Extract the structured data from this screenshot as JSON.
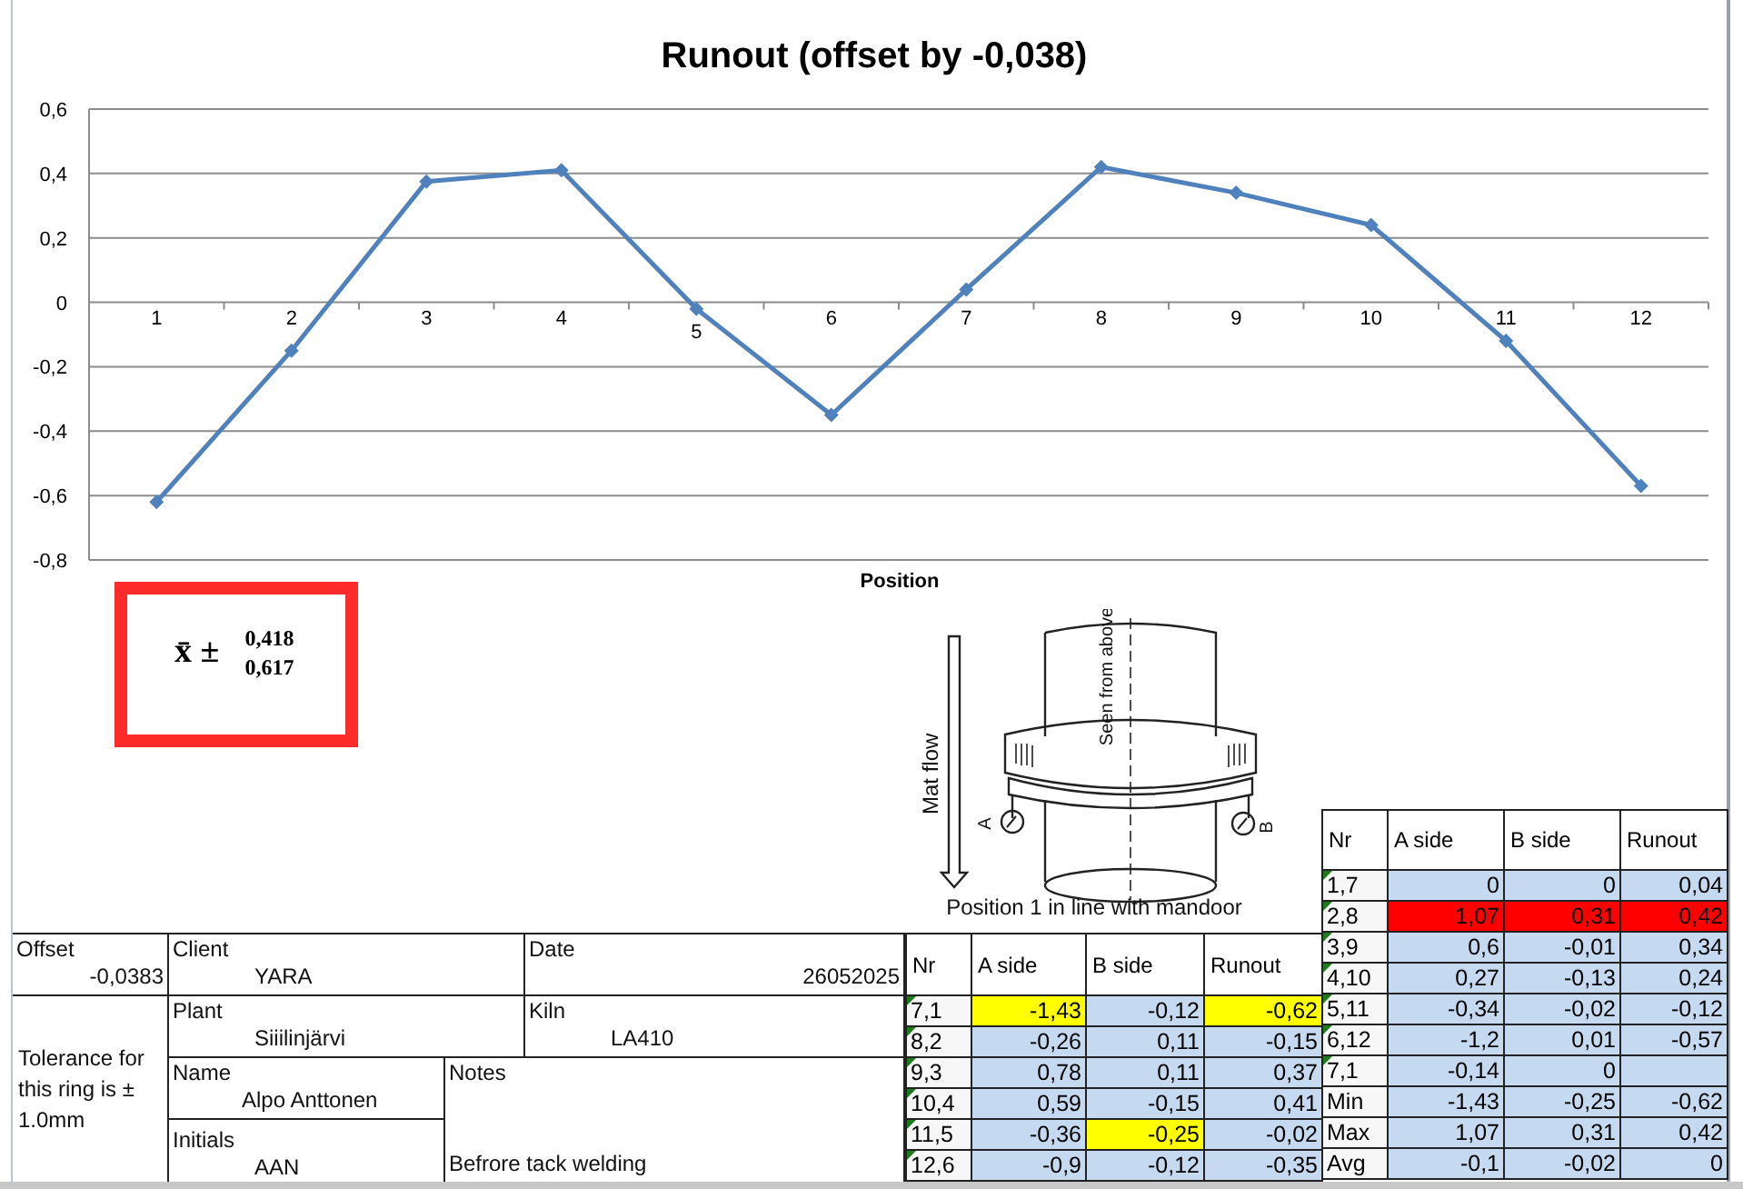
{
  "chart": {
    "chart_data": {
      "type": "line",
      "title": "Runout (offset by -0,038)",
      "xlabel": "Position",
      "categories": [
        "1",
        "2",
        "3",
        "4",
        "5",
        "6",
        "7",
        "8",
        "9",
        "10",
        "11",
        "12"
      ],
      "grid": true,
      "series": [
        {
          "color": "#4f81bd",
          "marker": "diamond",
          "values": [
            -0.62,
            -0.15,
            0.375,
            0.41,
            -0.02,
            -0.35,
            0.04,
            0.42,
            0.34,
            0.24,
            -0.12,
            -0.57
          ]
        }
      ],
      "ylim": [
        -0.8,
        0.6
      ],
      "yticks": [
        {
          "value": 0.6,
          "label": "0,6"
        },
        {
          "value": 0.4,
          "label": "0,4"
        },
        {
          "value": 0.2,
          "label": "0,2"
        },
        {
          "value": 0,
          "label": "0"
        },
        {
          "value": -0.2,
          "label": "-0,2"
        },
        {
          "value": -0.4,
          "label": "-0,4"
        },
        {
          "value": -0.6,
          "label": "-0,6"
        },
        {
          "value": -0.8,
          "label": "-0,8"
        }
      ]
    }
  },
  "stat_box": {
    "symbol": "x̄ ±",
    "values": [
      "0,418",
      "0,617"
    ]
  },
  "diagram": {
    "flow_label": "Mat flow",
    "view_label": "Seen from above",
    "gauge_labels": [
      "A",
      "B"
    ],
    "caption": "Position 1 in line with mandoor"
  },
  "info": [
    {
      "kind": "offset",
      "label": "Offset",
      "value": "-0,0383"
    },
    {
      "kind": "client",
      "label": "Client",
      "value": "YARA"
    },
    {
      "kind": "date",
      "label": "Date",
      "value": "26052025"
    },
    {
      "kind": "tolerance",
      "value": "Tolerance for this ring is ± 1.0mm"
    },
    {
      "kind": "plant",
      "label": "Plant",
      "value": "Siiilinjärvi"
    },
    {
      "kind": "kiln",
      "label": "Kiln",
      "value": "LA410"
    },
    {
      "kind": "name",
      "label": "Name",
      "value": "Alpo Anttonen"
    },
    {
      "kind": "initials",
      "label": "Initials",
      "value": "AAN"
    },
    {
      "kind": "notes",
      "label": "Notes",
      "value": "Befrore tack welding"
    }
  ],
  "measure_table": {
    "columns": [
      "Nr",
      "A side",
      "B side",
      "Runout"
    ],
    "rows": [
      {
        "nr": "7,1",
        "flag": true,
        "cells": [
          {
            "text": "-1,43",
            "color": "#ffff00"
          },
          {
            "text": "-0,12"
          },
          {
            "text": "-0,62",
            "color": "#ffff00"
          }
        ]
      },
      {
        "nr": "8,2",
        "flag": true,
        "cells": [
          {
            "text": "-0,26"
          },
          {
            "text": "0,11"
          },
          {
            "text": "-0,15"
          }
        ]
      },
      {
        "nr": "9,3",
        "flag": true,
        "cells": [
          {
            "text": "0,78"
          },
          {
            "text": "0,11"
          },
          {
            "text": "0,37"
          }
        ]
      },
      {
        "nr": "10,4",
        "flag": true,
        "cells": [
          {
            "text": "0,59"
          },
          {
            "text": "-0,15"
          },
          {
            "text": "0,41"
          }
        ]
      },
      {
        "nr": "11,5",
        "flag": true,
        "cells": [
          {
            "text": "-0,36"
          },
          {
            "text": "-0,25",
            "color": "#ffff00"
          },
          {
            "text": "-0,02"
          }
        ]
      },
      {
        "nr": "12,6",
        "flag": true,
        "cells": [
          {
            "text": "-0,9"
          },
          {
            "text": "-0,12"
          },
          {
            "text": "-0,35"
          }
        ]
      }
    ]
  },
  "summary_table": {
    "columns": [
      "Nr",
      "A side",
      "B side",
      "Runout"
    ],
    "rows": [
      {
        "nr": "1,7",
        "flag": true,
        "cells": [
          {
            "text": "0"
          },
          {
            "text": "0"
          },
          {
            "text": "0,04"
          }
        ]
      },
      {
        "nr": "2,8",
        "flag": true,
        "cells": [
          {
            "text": "1,07",
            "color": "#ff0000"
          },
          {
            "text": "0,31",
            "color": "#ff0000"
          },
          {
            "text": "0,42",
            "color": "#ff0000"
          }
        ]
      },
      {
        "nr": "3,9",
        "flag": true,
        "cells": [
          {
            "text": "0,6"
          },
          {
            "text": "-0,01"
          },
          {
            "text": "0,34"
          }
        ]
      },
      {
        "nr": "4,10",
        "flag": true,
        "cells": [
          {
            "text": "0,27"
          },
          {
            "text": "-0,13"
          },
          {
            "text": "0,24"
          }
        ]
      },
      {
        "nr": "5,11",
        "flag": true,
        "cells": [
          {
            "text": "-0,34"
          },
          {
            "text": "-0,02"
          },
          {
            "text": "-0,12"
          }
        ]
      },
      {
        "nr": "6,12",
        "flag": true,
        "cells": [
          {
            "text": "-1,2"
          },
          {
            "text": "0,01"
          },
          {
            "text": "-0,57"
          }
        ]
      },
      {
        "nr": "7,1",
        "flag": true,
        "cells": [
          {
            "text": "-0,14"
          },
          {
            "text": "0"
          },
          {}
        ]
      },
      {
        "nr": "Min",
        "flag": false,
        "cells": [
          {
            "text": "-1,43"
          },
          {
            "text": "-0,25"
          },
          {
            "text": "-0,62"
          }
        ]
      },
      {
        "nr": "Max",
        "flag": false,
        "cells": [
          {
            "text": "1,07"
          },
          {
            "text": "0,31"
          },
          {
            "text": "0,42"
          }
        ]
      },
      {
        "nr": "Avg",
        "flag": false,
        "cells": [
          {
            "text": "-0,1"
          },
          {
            "text": "-0,02"
          },
          {
            "text": "0"
          }
        ]
      }
    ]
  }
}
